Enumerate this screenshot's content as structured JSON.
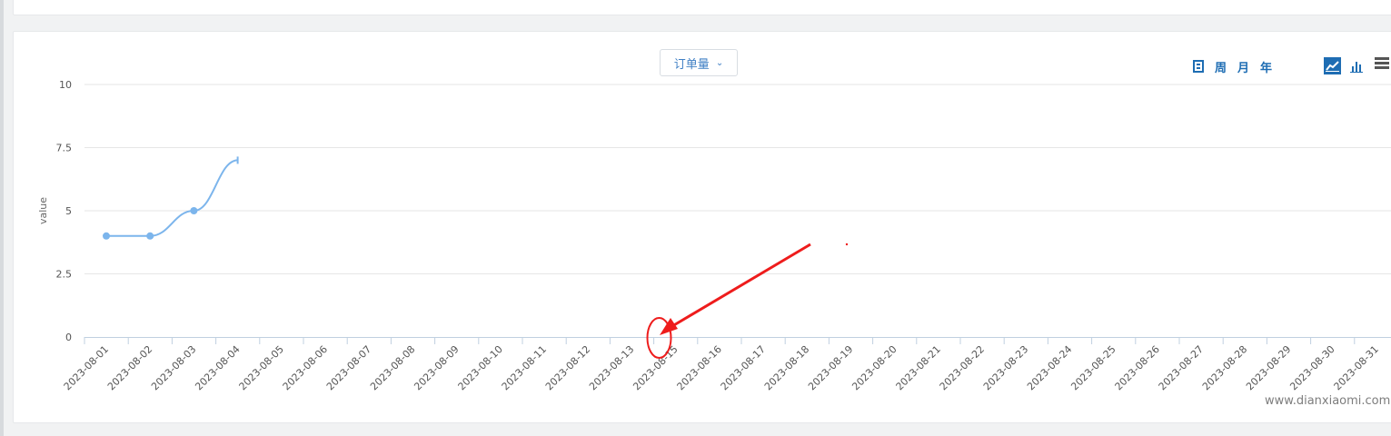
{
  "dropdown": {
    "label": "订单量",
    "icon": "chevron-down-icon"
  },
  "period_buttons": [
    {
      "key": "day",
      "icon": "calendar-icon",
      "label": ""
    },
    {
      "key": "week",
      "label": "周"
    },
    {
      "key": "month",
      "label": "月"
    },
    {
      "key": "year",
      "label": "年"
    }
  ],
  "chart_type_buttons": [
    {
      "key": "line",
      "icon": "line-chart-icon",
      "active": true
    },
    {
      "key": "bar",
      "icon": "bar-chart-icon",
      "active": false
    }
  ],
  "menu_icon": "hamburger-menu-icon",
  "colors": {
    "series": "#7cb5ec",
    "accent": "#1e6db3",
    "annotation": "#ee1c1c",
    "grid": "#e6e6e6",
    "axis": "#c0d0e0"
  },
  "watermark": "www.dianxiaomi.com",
  "chart_data": {
    "type": "line",
    "title": "",
    "xlabel": "",
    "ylabel": "value",
    "ylim": [
      0,
      10
    ],
    "yticks": [
      "0",
      "2.5",
      "5",
      "7.5",
      "10"
    ],
    "categories": [
      "2023-08-01",
      "2023-08-02",
      "2023-08-03",
      "2023-08-04",
      "2023-08-05",
      "2023-08-06",
      "2023-08-07",
      "2023-08-08",
      "2023-08-09",
      "2023-08-10",
      "2023-08-11",
      "2023-08-12",
      "2023-08-13",
      "2023-08-15",
      "2023-08-16",
      "2023-08-17",
      "2023-08-18",
      "2023-08-19",
      "2023-08-20",
      "2023-08-21",
      "2023-08-22",
      "2023-08-23",
      "2023-08-24",
      "2023-08-25",
      "2023-08-26",
      "2023-08-27",
      "2023-08-28",
      "2023-08-29",
      "2023-08-30",
      "2023-08-31"
    ],
    "series": [
      {
        "values": [
          4,
          4,
          5,
          7,
          null,
          null,
          null,
          null,
          null,
          null,
          null,
          null,
          null,
          null,
          null,
          null,
          null,
          null,
          null,
          null,
          null,
          null,
          null,
          null,
          null,
          null,
          null,
          null,
          null,
          null
        ]
      }
    ],
    "grid": true,
    "annotation": {
      "type": "circle-with-arrow",
      "points_to": "gap between 2023-08-13 and 2023-08-15"
    }
  }
}
